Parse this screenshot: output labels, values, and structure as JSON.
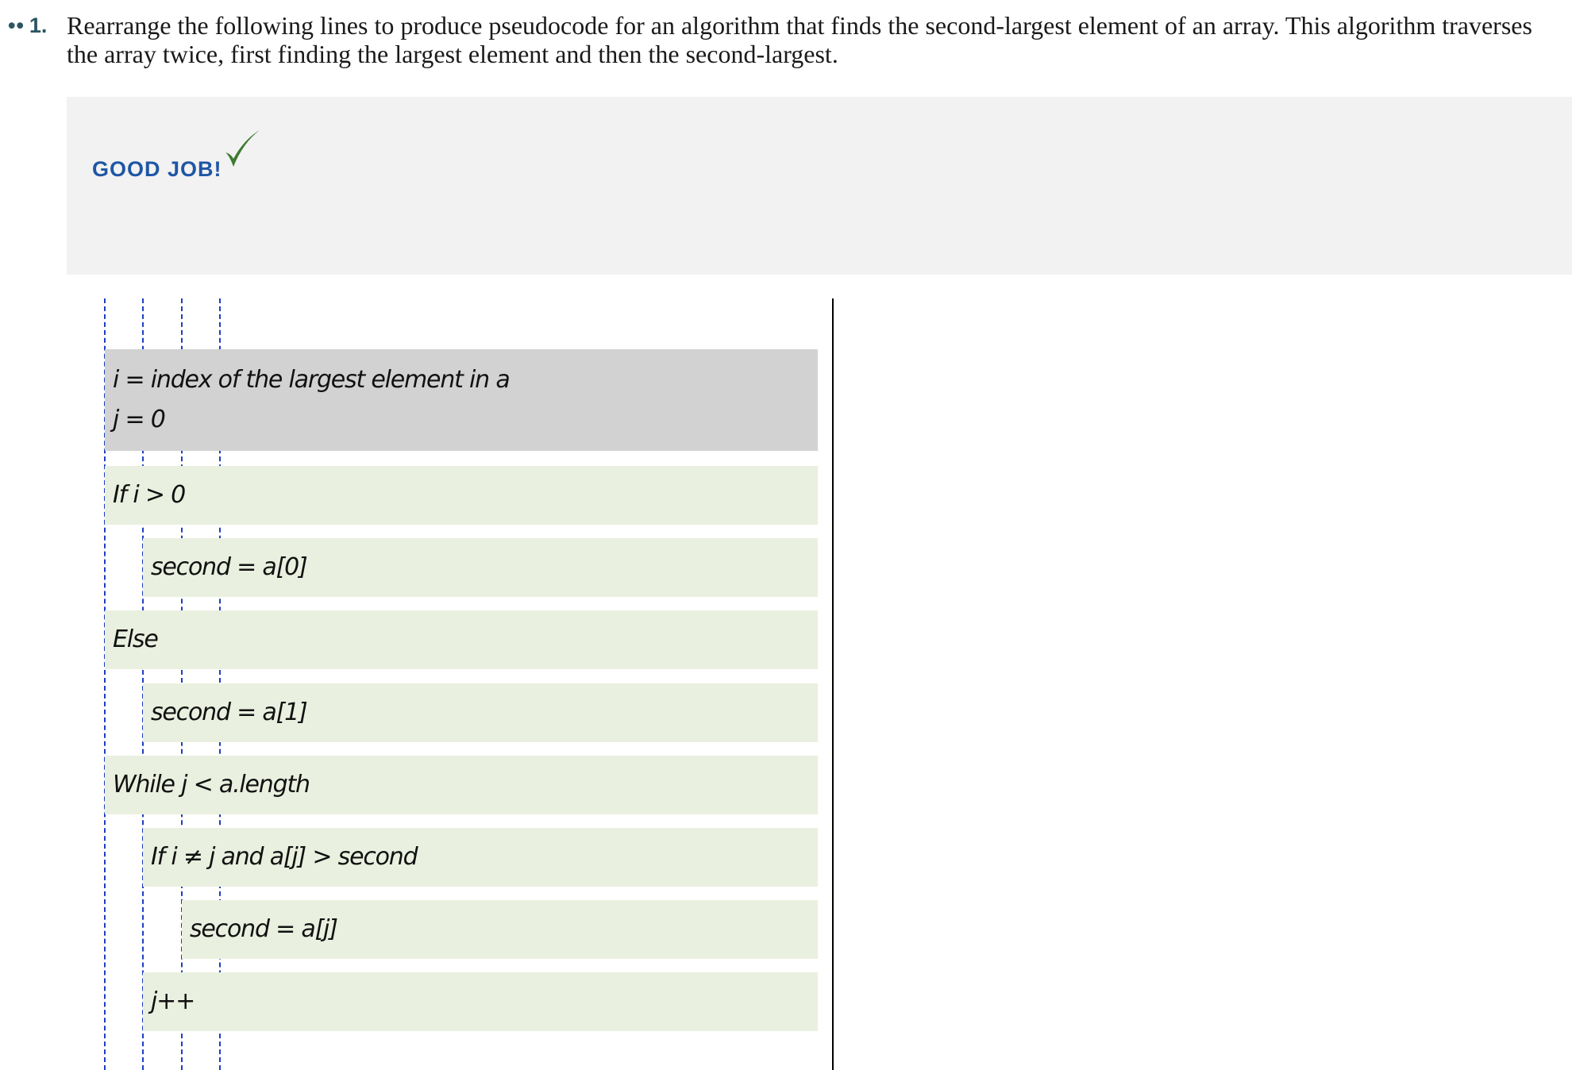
{
  "question": {
    "marker_dots": "••",
    "number": "1.",
    "text": "Rearrange the following lines to produce pseudocode for an algorithm that finds the second-largest element of an array. This algorithm traverses the array twice, first finding the largest element and then the second-largest."
  },
  "feedback": {
    "message": "GOOD JOB!",
    "icon": "checkmark-icon",
    "color": "#1f56a5",
    "check_color": "#3d7a2e"
  },
  "solution": {
    "blocks": [
      {
        "lines": [
          "i = index of the largest element in a",
          "j = 0"
        ],
        "indent": 0,
        "style": "given"
      },
      {
        "lines": [
          "If i > 0"
        ],
        "indent": 0,
        "style": "placed"
      },
      {
        "lines": [
          "second = a[0]"
        ],
        "indent": 1,
        "style": "placed"
      },
      {
        "lines": [
          "Else"
        ],
        "indent": 0,
        "style": "placed"
      },
      {
        "lines": [
          "second = a[1]"
        ],
        "indent": 1,
        "style": "placed"
      },
      {
        "lines": [
          "While j < a.length"
        ],
        "indent": 0,
        "style": "placed"
      },
      {
        "lines": [
          "If i ≠ j and a[j] > second"
        ],
        "indent": 1,
        "style": "placed"
      },
      {
        "lines": [
          "second = a[j]"
        ],
        "indent": 2,
        "style": "placed"
      },
      {
        "lines": [
          "j++"
        ],
        "indent": 1,
        "style": "placed"
      }
    ]
  },
  "colors": {
    "given_block": "#d2d2d2",
    "placed_block": "#eaf0df",
    "indent_guide": "#1d3fbf"
  }
}
